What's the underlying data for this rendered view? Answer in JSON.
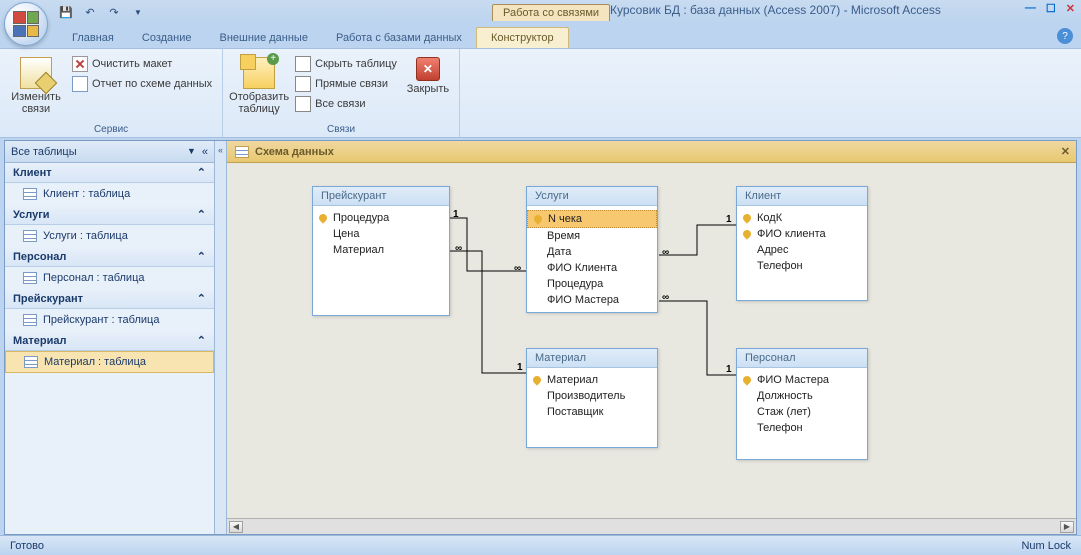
{
  "title": "Курсовик БД : база данных (Access 2007) - Microsoft Access",
  "context_tab_title": "Работа со связями",
  "tabs": [
    "Главная",
    "Создание",
    "Внешние данные",
    "Работа с базами данных",
    "Конструктор"
  ],
  "ribbon": {
    "group1": {
      "label": "Сервис",
      "edit_rel": "Изменить связи",
      "clear": "Очистить макет",
      "report": "Отчет по схеме данных"
    },
    "group2": {
      "label": "Связи",
      "show_table": "Отобразить таблицу",
      "hide": "Скрыть таблицу",
      "direct": "Прямые связи",
      "all": "Все связи",
      "close": "Закрыть"
    }
  },
  "nav": {
    "header": "Все таблицы",
    "groups": [
      {
        "name": "Клиент",
        "items": [
          "Клиент : таблица"
        ]
      },
      {
        "name": "Услуги",
        "items": [
          "Услуги : таблица"
        ]
      },
      {
        "name": "Персонал",
        "items": [
          "Персонал : таблица"
        ]
      },
      {
        "name": "Прейскурант",
        "items": [
          "Прейскурант : таблица"
        ]
      },
      {
        "name": "Материал",
        "items": [
          "Материал : таблица"
        ]
      }
    ]
  },
  "canvas_tab": "Схема данных",
  "tables": {
    "t1": {
      "name": "Прейскурант",
      "fields": [
        "Процедура",
        "Цена",
        "Материал"
      ],
      "pk": [
        0
      ]
    },
    "t2": {
      "name": "Услуги",
      "fields": [
        "N чека",
        "Время",
        "Дата",
        "ФИО Клиента",
        "Процедура",
        "ФИО Мастера"
      ],
      "pk": [
        0
      ],
      "sel": 0
    },
    "t3": {
      "name": "Клиент",
      "fields": [
        "КодК",
        "ФИО клиента",
        "Адрес",
        "Телефон"
      ],
      "pk": [
        0,
        1
      ]
    },
    "t4": {
      "name": "Материал",
      "fields": [
        "Материал",
        "Производитель",
        "Поставщик"
      ],
      "pk": [
        0
      ]
    },
    "t5": {
      "name": "Персонал",
      "fields": [
        "ФИО Мастера",
        "Должность",
        "Стаж (лет)",
        "Телефон"
      ],
      "pk": [
        0
      ]
    }
  },
  "rel_labels": {
    "one": "1",
    "many": "∞"
  },
  "status": {
    "ready": "Готово",
    "numlock": "Num Lock"
  }
}
